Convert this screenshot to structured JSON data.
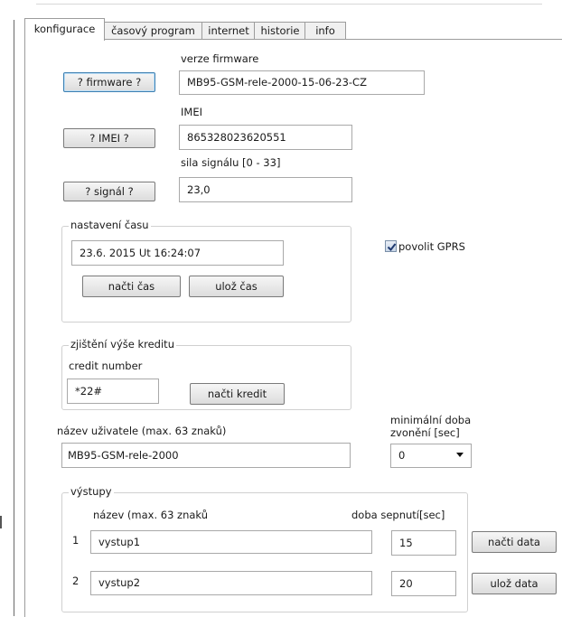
{
  "tabs": [
    "konfigurace",
    "časový program",
    "internet",
    "historie",
    "info"
  ],
  "firmware": {
    "button": "? firmware ?",
    "label": "verze firmware",
    "value": "MB95-GSM-rele-2000-15-06-23-CZ"
  },
  "imei": {
    "button": "? IMEI ?",
    "label": "IMEI",
    "value": "865328023620551"
  },
  "signal": {
    "button": "? signál ?",
    "label": "sila signálu [0 - 33]",
    "value": "23,0"
  },
  "time": {
    "legend": "nastavení času",
    "value": "23.6. 2015 Ut 16:24:07",
    "read_button": "načti čas",
    "save_button": "ulož čas"
  },
  "gprs": {
    "label": "povolit GPRS",
    "checked": true
  },
  "credit": {
    "legend": "zjištění výše kreditu",
    "number_label": "credit number",
    "number_value": "*22#",
    "read_button": "načti kredit"
  },
  "user": {
    "label": "název uživatele (max. 63 znaků)",
    "value": "MB95-GSM-rele-2000"
  },
  "ring": {
    "label_line1": "minimální doba",
    "label_line2": "zvonění [sec]",
    "value": "0"
  },
  "outputs": {
    "legend": "výstupy",
    "name_header": "název (max.  63 znaků",
    "time_header": "doba sepnutí[sec]",
    "rows": [
      {
        "index": "1",
        "name": "vystup1",
        "time": "15"
      },
      {
        "index": "2",
        "name": "vystup2",
        "time": "20"
      }
    ],
    "read_button": "načti data",
    "save_button": "ulož data"
  }
}
